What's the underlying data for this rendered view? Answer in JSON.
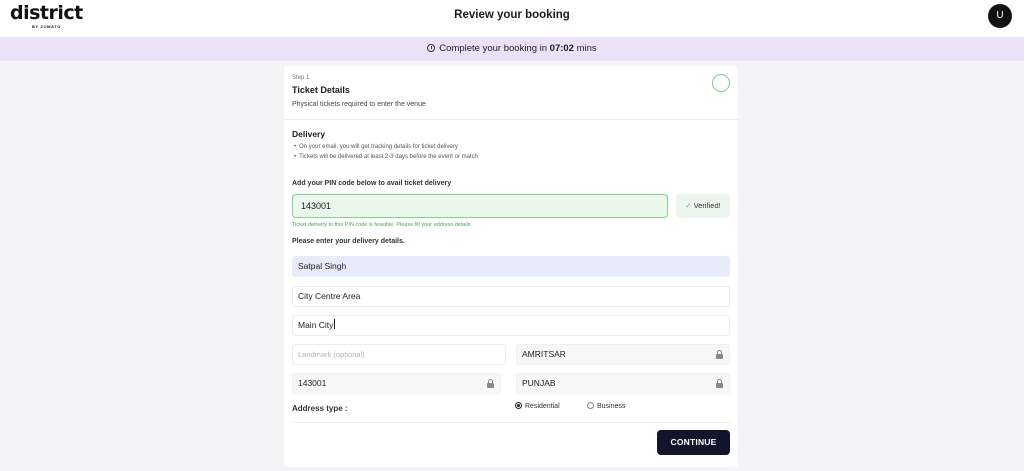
{
  "header": {
    "logo": "district",
    "logo_sub": "BY ZOMATO",
    "title": "Review your booking",
    "avatar_initial": "U"
  },
  "timer": {
    "prefix": "Complete your booking in",
    "time": "07:02",
    "suffix": "mins"
  },
  "step": {
    "label": "Step 1",
    "title": "Ticket Details",
    "subtitle": "Physical tickets required to enter the venue"
  },
  "delivery": {
    "title": "Delivery",
    "bullets": [
      "On your email, you will get tracking details for ticket delivery",
      "Tickets will be delivered at least 2-3 days before the event or match"
    ],
    "pin_label": "Add your PIN code below to avail ticket delivery",
    "pin_value": "143001",
    "verified_label": "Verified!",
    "pin_hint": "Ticket delivery to this PIN code is feasible. Please fill your address details",
    "details_label": "Please enter your delivery details."
  },
  "form": {
    "name": "Satpal Singh",
    "address_line1": "City Centre Area",
    "address_line2": "Main City",
    "landmark_placeholder": "Landmark (optional)",
    "city": "AMRITSAR",
    "pincode": "143001",
    "state": "PUNJAB"
  },
  "address_type": {
    "label": "Address type :",
    "options": [
      "Residential",
      "Business"
    ],
    "selected": "Residential"
  },
  "continue_label": "CONTINUE",
  "colors": {
    "timer_bg": "#ebe2f9",
    "verified_green": "#83cf8e",
    "button_navy": "#10152b"
  }
}
